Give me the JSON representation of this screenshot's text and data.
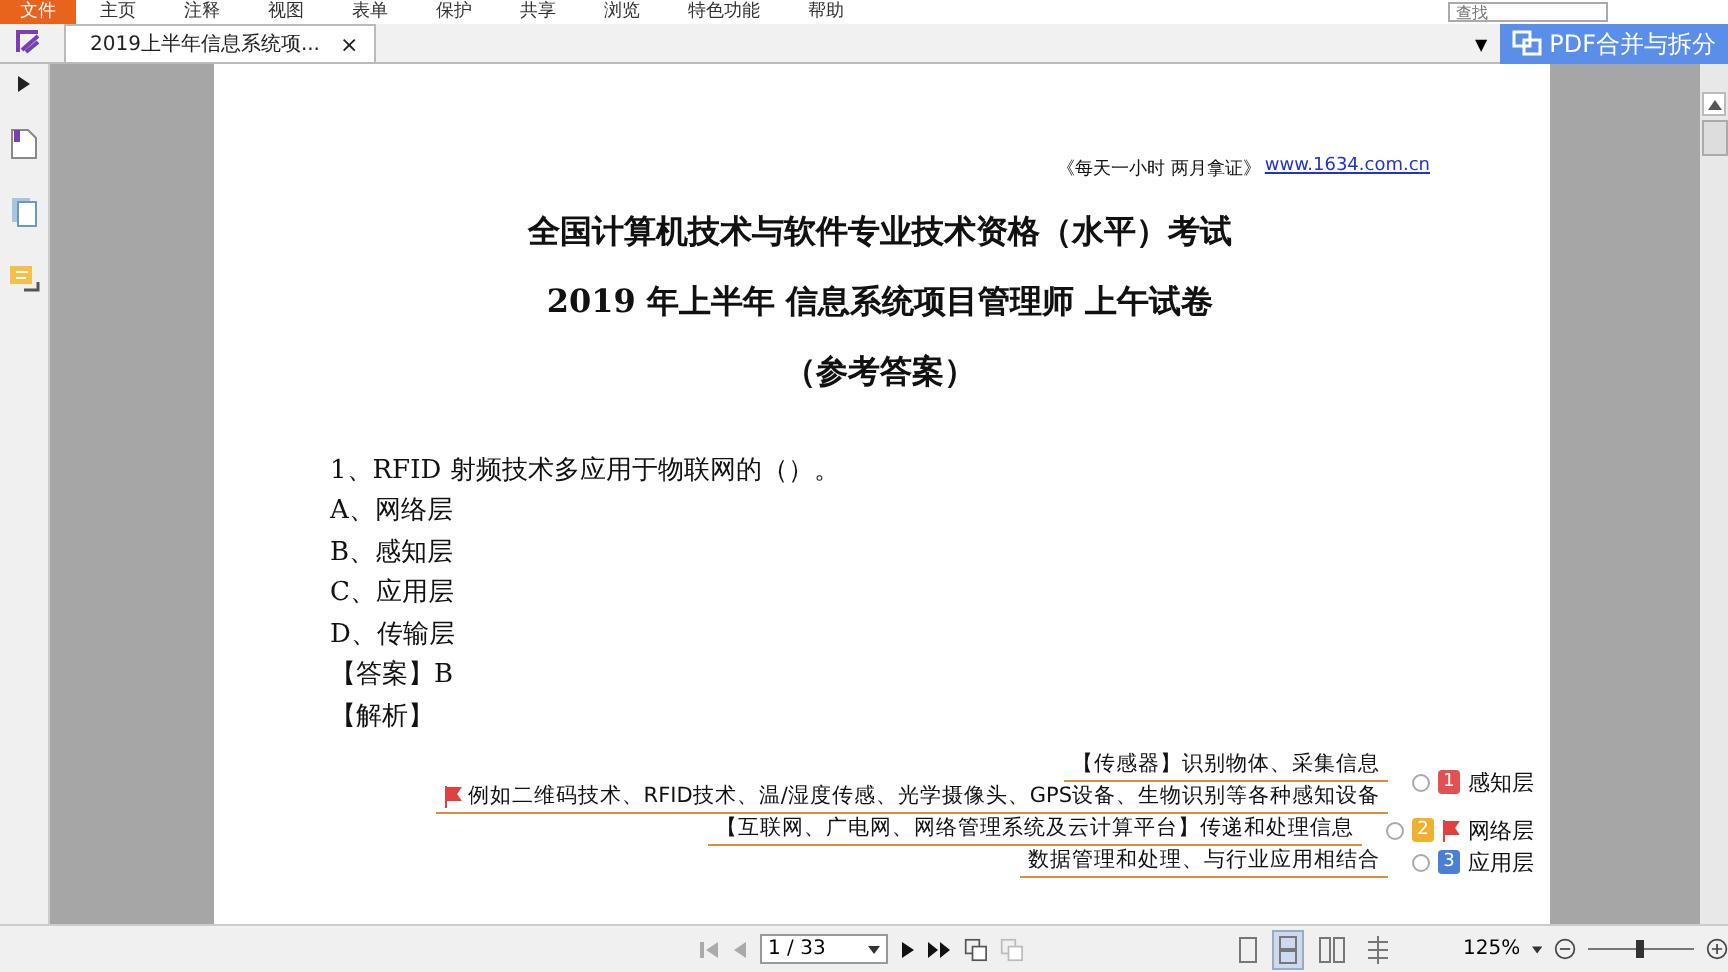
{
  "menu": [
    {
      "label": "文件",
      "selected": true
    },
    {
      "label": "主页",
      "selected": false
    },
    {
      "label": "注释",
      "selected": false
    },
    {
      "label": "视图",
      "selected": false
    },
    {
      "label": "表单",
      "selected": false
    },
    {
      "label": "保护",
      "selected": false
    },
    {
      "label": "共享",
      "selected": false
    },
    {
      "label": "浏览",
      "selected": false
    },
    {
      "label": "特色功能",
      "selected": false
    },
    {
      "label": "帮助",
      "selected": false
    }
  ],
  "search": {
    "placeholder": "查找"
  },
  "tabs": [
    {
      "label": "2019上半年信息系统项...",
      "close": "×",
      "selected": true
    }
  ],
  "tab_dropdown": "▼",
  "promo_button": "PDF合并与拆分",
  "document": {
    "header_note": "《每天一小时  两月拿证》",
    "header_link": "www.1634.com.cn",
    "titles": [
      "全国计算机技术与软件专业技术资格（水平）考试",
      "2019 年上半年 信息系统项目管理师 上午试卷",
      "（参考答案）"
    ],
    "question": "1、RFID 射频技术多应用于物联网的（）。",
    "options": [
      "A、网络层",
      "B、感知层",
      "C、应用层",
      "D、传输层"
    ],
    "answer": "【答案】B",
    "analysis": "【解析】",
    "mindmap": [
      {
        "badge": "1",
        "color": "#e05252",
        "label": "感知层",
        "flag": false,
        "branches": [
          {
            "text": "【传感器】识别物体、采集信息",
            "flag": false
          },
          {
            "text": "例如二维码技术、RFID技术、温/湿度传感、光学摄像头、GPS设备、生物识别等各种感知设备",
            "flag": true
          }
        ]
      },
      {
        "badge": "2",
        "color": "#f0b030",
        "label": "网络层",
        "flag": true,
        "branches": [
          {
            "text": "【互联网、广电网、网络管理系统及云计算平台】传递和处理信息",
            "flag": false
          }
        ]
      },
      {
        "badge": "3",
        "color": "#4a7fd4",
        "label": "应用层",
        "flag": false,
        "branches": [
          {
            "text": "数据管理和处理、与行业应用相结合",
            "flag": false
          }
        ]
      }
    ]
  },
  "status": {
    "page_field": "1 / 33",
    "nav": [
      {
        "kind": "first",
        "disabled": true
      },
      {
        "kind": "prev",
        "disabled": true
      },
      {
        "kind": "next",
        "disabled": false
      },
      {
        "kind": "last",
        "disabled": false
      }
    ],
    "views": [
      {
        "kind": "single",
        "selected": false
      },
      {
        "kind": "continuous",
        "selected": true
      },
      {
        "kind": "facing",
        "selected": false
      },
      {
        "kind": "split",
        "selected": false
      }
    ],
    "zoom": "125%",
    "zoom_slider": {
      "level": 0.48
    }
  }
}
